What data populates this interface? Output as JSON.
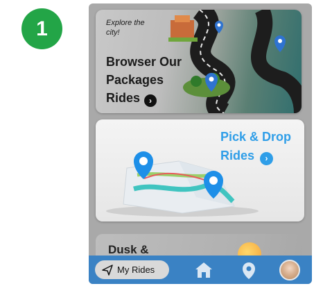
{
  "step": "1",
  "cards": {
    "packages": {
      "tagline": "Explore the city!",
      "title": "Browser Our Packages Rides"
    },
    "pick_drop": {
      "title": "Pick & Drop Rides"
    },
    "dusk": {
      "title": "Dusk &"
    }
  },
  "nav": {
    "my_rides": "My Rides"
  },
  "icons": {
    "step_badge": "number-badge",
    "packages_arrow": "chevron-right-circle-icon",
    "pickdrop_arrow": "chevron-right-circle-icon",
    "my_rides": "send-icon",
    "home": "home-icon",
    "location": "location-pin-icon",
    "profile": "avatar"
  },
  "colors": {
    "step_badge": "#23a547",
    "nav_bar": "#3a82c4",
    "pickdrop_text": "#2f9ee8",
    "phone_bg": "#a9a9a9"
  }
}
